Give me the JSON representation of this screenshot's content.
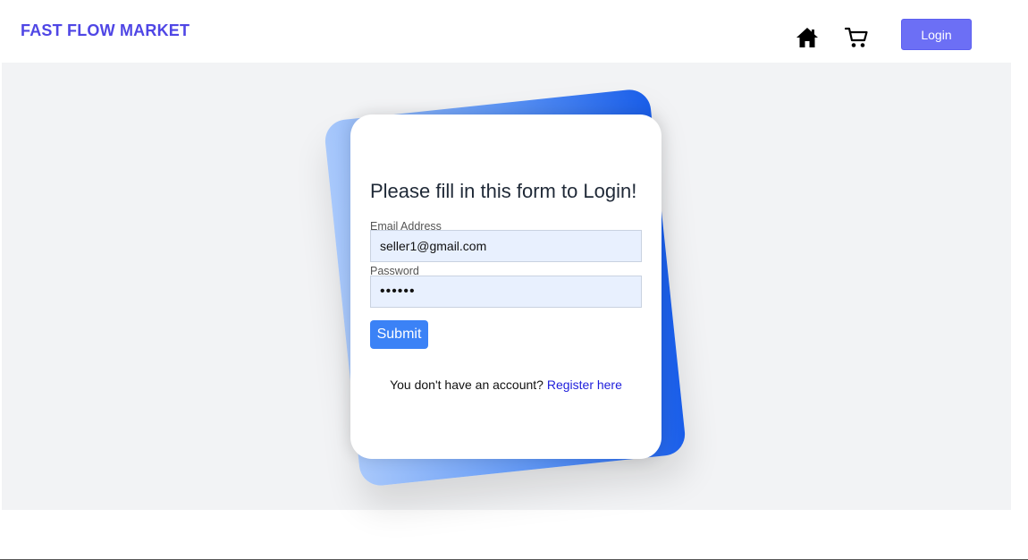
{
  "header": {
    "brand": "FAST FLOW MARKET",
    "home_icon": "home-icon",
    "cart_icon": "cart-icon",
    "login_label": "Login"
  },
  "form": {
    "title": "Please fill in this form to Login!",
    "email_label": "Email Address",
    "email_value": "seller1@gmail.com",
    "password_label": "Password",
    "password_value": "••••••",
    "submit_label": "Submit",
    "register_prompt": "You don't have an account?",
    "register_link": "Register here"
  },
  "colors": {
    "brand": "#4f46e5",
    "login_button": "#6c6ff5",
    "submit_button": "#3b82f6",
    "link": "#1e1edb",
    "input_background": "#e8f0fe",
    "page_background": "#f2f3f5"
  }
}
